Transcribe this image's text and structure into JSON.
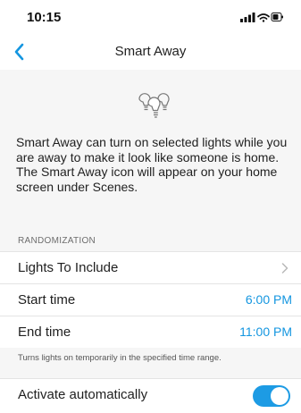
{
  "status_bar": {
    "time": "10:15",
    "icons": [
      "signal-icon",
      "wifi-icon",
      "battery-icon"
    ]
  },
  "nav": {
    "title": "Smart Away",
    "back_icon": "chevron-left-icon"
  },
  "hero_icon": "light-bulbs-icon",
  "description": "Smart Away can turn on selected lights while you are away to make it look like someone is home. The Smart Away icon will appear on your home screen under Scenes.",
  "randomization": {
    "header": "RANDOMIZATION",
    "rows": [
      {
        "label": "Lights To Include",
        "value": null,
        "icon": "chevron-right-icon"
      },
      {
        "label": "Start time",
        "value": "6:00 PM"
      },
      {
        "label": "End time",
        "value": "11:00 PM"
      }
    ],
    "footnote": "Turns lights on temporarily in the specified time range."
  },
  "activate": {
    "label": "Activate automatically",
    "enabled": true
  },
  "colors": {
    "accent": "#1496e0",
    "toggle_on": "#1d9be4",
    "background": "#f6f6f6"
  }
}
